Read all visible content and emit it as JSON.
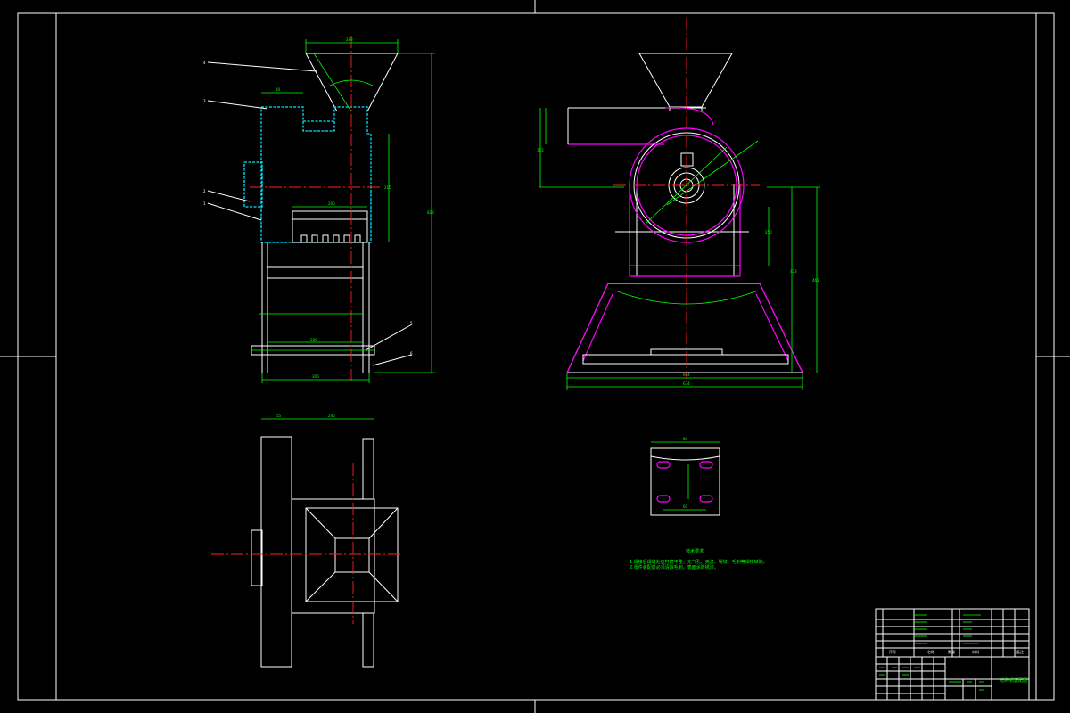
{
  "tech_requirements": {
    "title": "技术要求",
    "lines": [
      "1.焊接后焊缝处应打磨平整，无气孔、夹渣、裂纹、毛刺等焊接缺陷。",
      "2.零件装配前必须清除毛刺，表面涂防锈漆。"
    ]
  },
  "part_labels": [
    "4",
    "3",
    "2",
    "1",
    "5",
    "6"
  ],
  "title_block": {
    "drawing_name": "粉碎机装配图",
    "headers": [
      "序号",
      "名称",
      "数量",
      "材料",
      "备注"
    ]
  }
}
